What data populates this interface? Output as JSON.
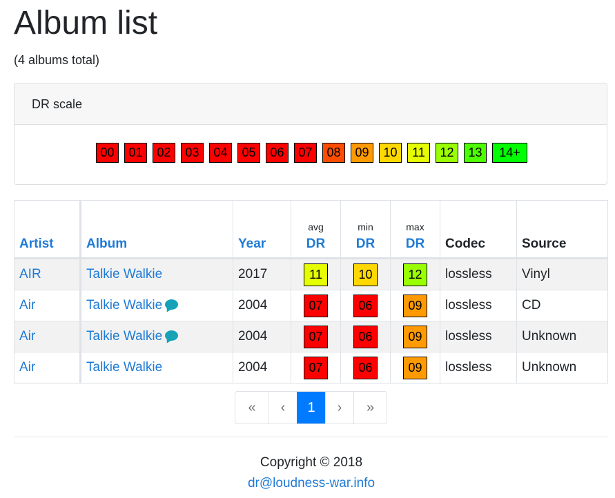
{
  "page": {
    "title": "Album list",
    "subtitle": "(4 albums total)"
  },
  "dr_scale": {
    "header": "DR scale",
    "items": [
      {
        "label": "00",
        "color": "#ff0000"
      },
      {
        "label": "01",
        "color": "#ff0000"
      },
      {
        "label": "02",
        "color": "#ff0000"
      },
      {
        "label": "03",
        "color": "#ff0000"
      },
      {
        "label": "04",
        "color": "#ff0000"
      },
      {
        "label": "05",
        "color": "#ff0000"
      },
      {
        "label": "06",
        "color": "#ff0000"
      },
      {
        "label": "07",
        "color": "#ff0000"
      },
      {
        "label": "08",
        "color": "#ff4d00"
      },
      {
        "label": "09",
        "color": "#ff9a00"
      },
      {
        "label": "10",
        "color": "#ffd800"
      },
      {
        "label": "11",
        "color": "#e6ff00"
      },
      {
        "label": "12",
        "color": "#9aff00"
      },
      {
        "label": "13",
        "color": "#4dff00"
      },
      {
        "label": "14+",
        "color": "#00ff00"
      }
    ]
  },
  "table": {
    "headers": {
      "artist": "Artist",
      "album": "Album",
      "year": "Year",
      "avg_small": "avg",
      "min_small": "min",
      "max_small": "max",
      "dr": "DR",
      "codec": "Codec",
      "source": "Source"
    },
    "rows": [
      {
        "artist": "AIR",
        "album": "Talkie Walkie",
        "comment": false,
        "year": "2017",
        "avg": {
          "label": "11",
          "color": "#e6ff00"
        },
        "min": {
          "label": "10",
          "color": "#ffd800"
        },
        "max": {
          "label": "12",
          "color": "#9aff00"
        },
        "codec": "lossless",
        "source": "Vinyl"
      },
      {
        "artist": "Air",
        "album": "Talkie Walkie",
        "comment": true,
        "year": "2004",
        "avg": {
          "label": "07",
          "color": "#ff0000"
        },
        "min": {
          "label": "06",
          "color": "#ff0000"
        },
        "max": {
          "label": "09",
          "color": "#ff9a00"
        },
        "codec": "lossless",
        "source": "CD"
      },
      {
        "artist": "Air",
        "album": "Talkie Walkie",
        "comment": true,
        "year": "2004",
        "avg": {
          "label": "07",
          "color": "#ff0000"
        },
        "min": {
          "label": "06",
          "color": "#ff0000"
        },
        "max": {
          "label": "09",
          "color": "#ff9a00"
        },
        "codec": "lossless",
        "source": "Unknown"
      },
      {
        "artist": "Air",
        "album": "Talkie Walkie",
        "comment": false,
        "year": "2004",
        "avg": {
          "label": "07",
          "color": "#ff0000"
        },
        "min": {
          "label": "06",
          "color": "#ff0000"
        },
        "max": {
          "label": "09",
          "color": "#ff9a00"
        },
        "codec": "lossless",
        "source": "Unknown"
      }
    ]
  },
  "pagination": {
    "first": "«",
    "prev": "‹",
    "current": "1",
    "next": "›",
    "last": "»"
  },
  "footer": {
    "copyright": "Copyright © 2018",
    "email": "dr@loudness-war.info"
  }
}
